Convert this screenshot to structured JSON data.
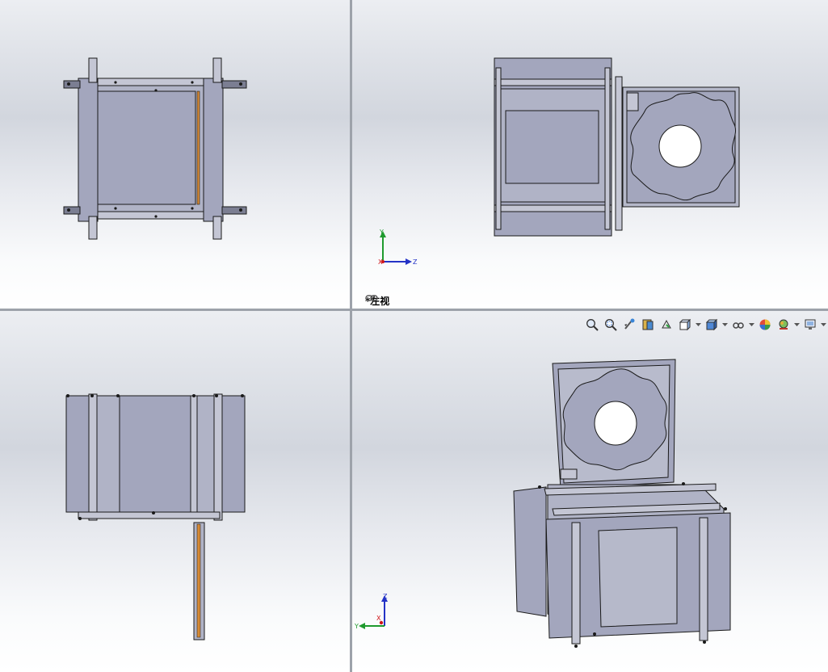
{
  "viewports": {
    "top": {
      "name": "top-view"
    },
    "left": {
      "name": "left-view",
      "label": "*左视"
    },
    "front": {
      "name": "front-view"
    },
    "iso": {
      "name": "isometric-view"
    }
  },
  "triads": {
    "left": {
      "axis1": "Y",
      "axis2": "Z",
      "axis3": "X"
    },
    "iso": {
      "axis1": "Z",
      "axis2": "Y",
      "axis3": "X"
    }
  },
  "toolbar": {
    "icons": [
      "zoom-to-fit-icon",
      "zoom-to-area-icon",
      "previous-view-icon",
      "section-view-icon",
      "dynamic-annotation-icon",
      "view-orientation-icon",
      "display-style-icon",
      "hide-show-items-icon",
      "edit-appearance-icon",
      "apply-scene-icon",
      "view-settings-icon"
    ]
  },
  "colors": {
    "part_fill": "#a3a6bd",
    "part_edge": "#1a1a1a",
    "accent_orange": "#d68a35",
    "background_top": "#dfe2e8",
    "background_bottom": "#ffffff",
    "triad_x": "#d0161a",
    "triad_y": "#1f9a2e",
    "triad_z": "#2433c6"
  }
}
